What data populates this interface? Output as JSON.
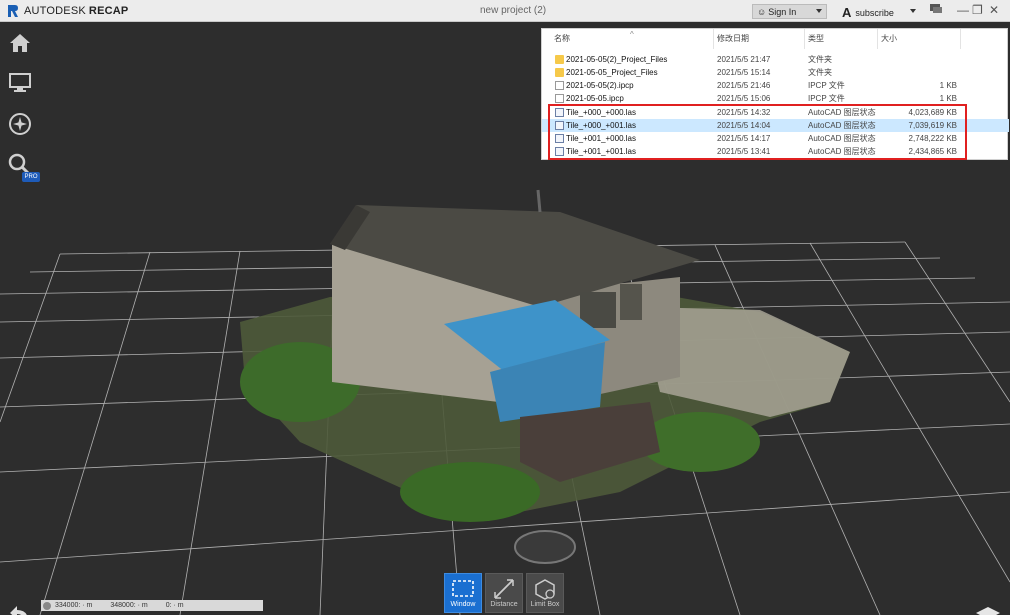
{
  "titlebar": {
    "app_name_light": "AUTODESK",
    "app_name_bold": "RECAP",
    "doc_title": "new project (2)",
    "sign_in": "Sign In",
    "subscribe": "subscribe",
    "autodesk_letter": "A"
  },
  "left_toolbar": {
    "items": [
      {
        "icon": "home-icon"
      },
      {
        "icon": "monitor-icon"
      },
      {
        "icon": "compass-icon"
      },
      {
        "icon": "search-icon"
      }
    ],
    "pro_badge": "PRO"
  },
  "explorer": {
    "headers": {
      "name": "名称",
      "date": "修改日期",
      "type": "类型",
      "size": "大小"
    },
    "rows": [
      {
        "name": "2021-05-05(2)_Project_Files",
        "date": "2021/5/5 21:47",
        "type": "文件夹",
        "size": "",
        "icon": "folder-icon"
      },
      {
        "name": "2021-05-05_Project_Files",
        "date": "2021/5/5 15:14",
        "type": "文件夹",
        "size": "",
        "icon": "folder-icon"
      },
      {
        "name": "2021-05-05(2).ipcp",
        "date": "2021/5/5 21:46",
        "type": "IPCP 文件",
        "size": "1 KB",
        "icon": "file-icon"
      },
      {
        "name": "2021-05-05.ipcp",
        "date": "2021/5/5 15:06",
        "type": "IPCP 文件",
        "size": "1 KB",
        "icon": "file-icon"
      },
      {
        "name": "Tile_+000_+000.las",
        "date": "2021/5/5 14:32",
        "type": "AutoCAD 图层状态",
        "size": "4,023,689 KB",
        "icon": "las-file-icon"
      },
      {
        "name": "Tile_+000_+001.las",
        "date": "2021/5/5 14:04",
        "type": "AutoCAD 图层状态",
        "size": "7,039,619 KB",
        "icon": "las-file-icon"
      },
      {
        "name": "Tile_+001_+000.las",
        "date": "2021/5/5 14:17",
        "type": "AutoCAD 图层状态",
        "size": "2,748,222 KB",
        "icon": "las-file-icon"
      },
      {
        "name": "Tile_+001_+001.las",
        "date": "2021/5/5 13:41",
        "type": "AutoCAD 图层状态",
        "size": "2,434,865 KB",
        "icon": "las-file-icon"
      }
    ]
  },
  "bottom": {
    "coords": {
      "x": "334000: · m",
      "y": "348000: · m",
      "z": "0: · m"
    },
    "tools": [
      {
        "label": "Window",
        "active": true
      },
      {
        "label": "Distance",
        "active": false
      },
      {
        "label": "Limit Box",
        "active": false
      }
    ]
  },
  "colors": {
    "accent": "#1a6fd1",
    "highlight_border": "#e02020",
    "selected_row": "#cce8ff"
  }
}
